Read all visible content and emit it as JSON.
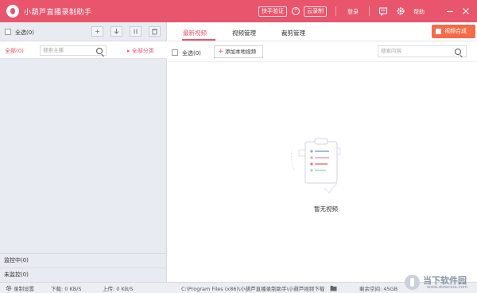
{
  "app": {
    "title": "小葫芦直播录制助手",
    "brand_color": "#e8556d"
  },
  "titlebar": {
    "verify_label": "快手验证",
    "help_q": "?",
    "cloud_record_label": "云录制",
    "login_label": "登录",
    "help_label": "帮助",
    "icons": [
      "message-icon",
      "gear-icon",
      "minimize-icon",
      "close-icon"
    ]
  },
  "left": {
    "select_all_label": "全选(0)",
    "filter_all_label": "全部(0)",
    "search_placeholder": "搜索主播",
    "category_label": "▸ 全部分类",
    "monitoring_label": "监控中(0)",
    "unmonitored_label": "未监控(0)"
  },
  "main": {
    "tabs": [
      {
        "label": "最新视频",
        "active": true
      },
      {
        "label": "视频管理",
        "active": false
      },
      {
        "label": "裁剪管理",
        "active": false
      }
    ],
    "merge_label": "视频合成",
    "select_all_label": "全选(0)",
    "add_local_label": "添加本地视频",
    "search_placeholder": "搜索内容",
    "empty_text": "暂无视频"
  },
  "statusbar": {
    "record_settings": "录制设置",
    "download": "下载: 0 KB/S",
    "upload": "上传: 0 KB/S",
    "path": "C:\\Program Files (x86)\\小葫芦直播录制助手\\小葫芦视频下载",
    "free_space": "剩余空间: 45GB"
  },
  "watermark": {
    "title": "当下软件园",
    "subtitle": "www.downxia.com"
  }
}
